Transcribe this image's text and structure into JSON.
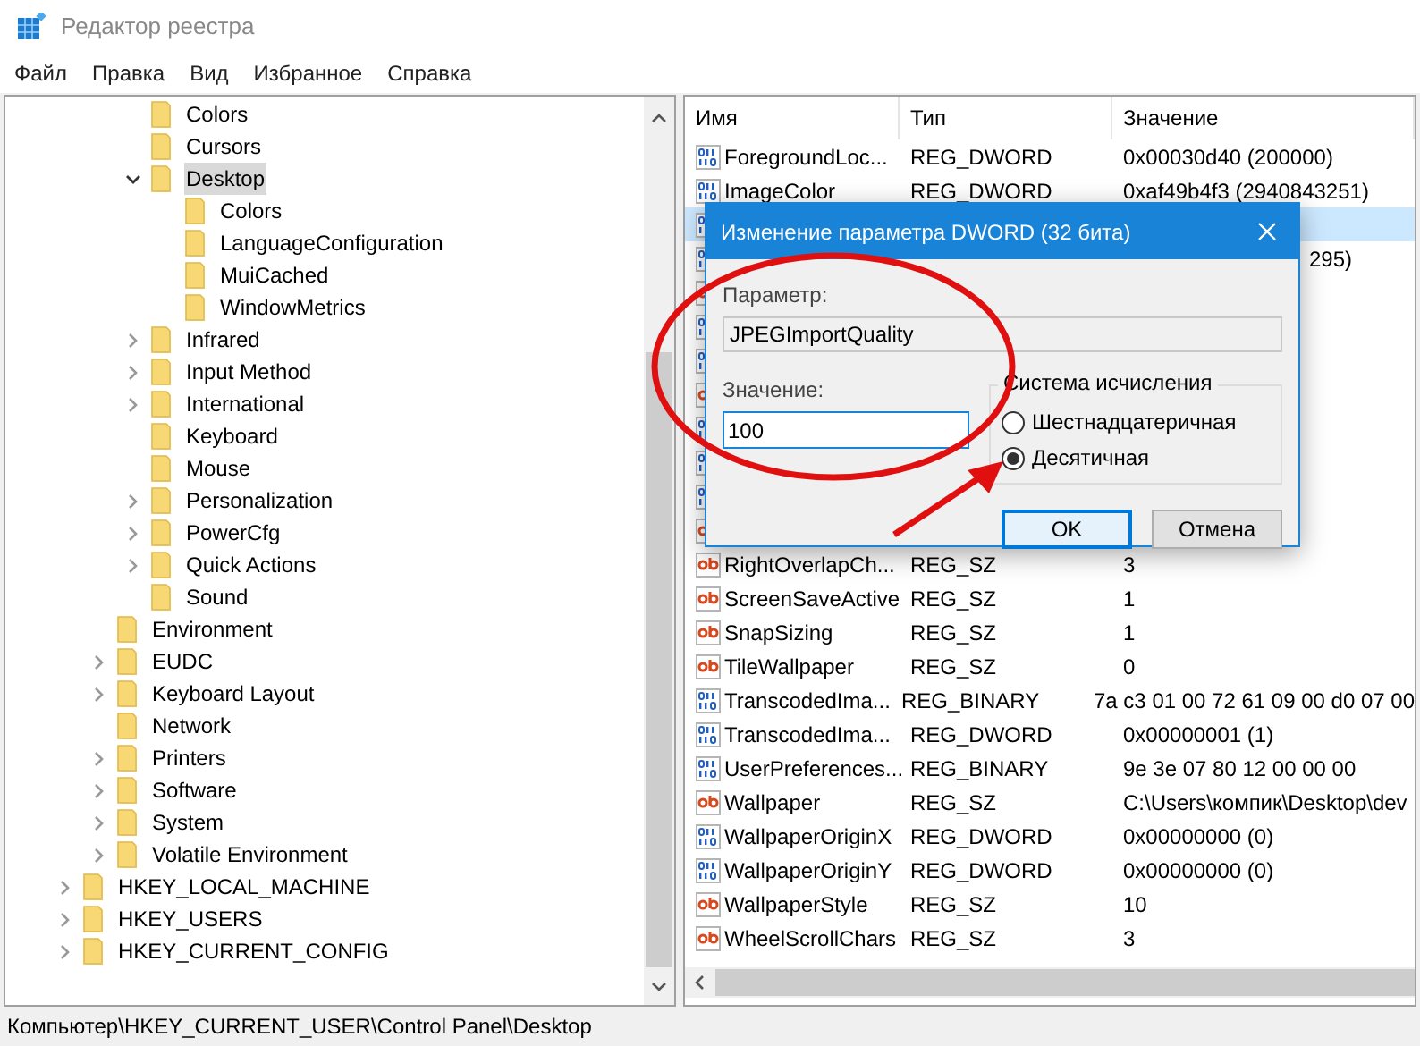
{
  "window": {
    "title": "Редактор реестра"
  },
  "menu": [
    "Файл",
    "Правка",
    "Вид",
    "Избранное",
    "Справка"
  ],
  "tree": [
    {
      "children": [
        {
          "children": [
            {
              "label": "Colors",
              "selected": false
            },
            {
              "label": "Cursors",
              "selected": false
            },
            {
              "label": "Desktop",
              "selected": true,
              "expanded": true,
              "children": [
                {
                  "label": "Colors",
                  "selected": false
                },
                {
                  "label": "LanguageConfiguration",
                  "selected": false
                },
                {
                  "label": "MuiCached",
                  "selected": false
                },
                {
                  "label": "WindowMetrics",
                  "selected": false
                }
              ]
            },
            {
              "label": "Infrared",
              "selected": false,
              "expanded": false
            },
            {
              "label": "Input Method",
              "selected": false,
              "expanded": false
            },
            {
              "label": "International",
              "selected": false,
              "expanded": false
            },
            {
              "label": "Keyboard",
              "selected": false
            },
            {
              "label": "Mouse",
              "selected": false
            },
            {
              "label": "Personalization",
              "selected": false,
              "expanded": false
            },
            {
              "label": "PowerCfg",
              "selected": false,
              "expanded": false
            },
            {
              "label": "Quick Actions",
              "selected": false,
              "expanded": false
            },
            {
              "label": "Sound",
              "selected": false
            }
          ]
        },
        {
          "label": "Environment",
          "selected": false
        },
        {
          "label": "EUDC",
          "selected": false,
          "expanded": false
        },
        {
          "label": "Keyboard Layout",
          "selected": false,
          "expanded": false
        },
        {
          "label": "Network",
          "selected": false
        },
        {
          "label": "Printers",
          "selected": false,
          "expanded": false
        },
        {
          "label": "Software",
          "selected": false,
          "expanded": false
        },
        {
          "label": "System",
          "selected": false,
          "expanded": false
        },
        {
          "label": "Volatile Environment",
          "selected": false,
          "expanded": false
        }
      ]
    },
    {
      "label": "HKEY_LOCAL_MACHINE",
      "selected": false,
      "expanded": false
    },
    {
      "label": "HKEY_USERS",
      "selected": false,
      "expanded": false
    },
    {
      "label": "HKEY_CURRENT_CONFIG",
      "selected": false,
      "expanded": false
    }
  ],
  "table": {
    "columns": [
      "Имя",
      "Тип",
      "Значение"
    ],
    "rows": [
      {
        "kind": "dword",
        "selected": false,
        "name": "ForegroundLoc...",
        "type": "REG_DWORD",
        "value": "0x00030d40 (200000)"
      },
      {
        "kind": "dword",
        "selected": false,
        "name": "ImageColor",
        "type": "REG_DWORD",
        "value": "0xaf49b4f3 (2940843251)"
      },
      {
        "kind": "dword",
        "selected": true
      },
      {
        "kind": "dword",
        "selected": false,
        "value_tail": "295)"
      },
      {
        "kind": "sz",
        "selected": false
      },
      {
        "kind": "dword",
        "selected": false
      },
      {
        "kind": "dword",
        "selected": false
      },
      {
        "kind": "sz",
        "selected": false
      },
      {
        "kind": "dword",
        "selected": false
      },
      {
        "kind": "dword",
        "selected": false
      },
      {
        "kind": "dword",
        "selected": false
      },
      {
        "kind": "sz",
        "selected": false
      },
      {
        "kind": "sz",
        "selected": false,
        "name": "RightOverlapCh...",
        "type": "REG_SZ",
        "value": "3"
      },
      {
        "kind": "sz",
        "selected": false,
        "name": "ScreenSaveActive",
        "type": "REG_SZ",
        "value": "1"
      },
      {
        "kind": "sz",
        "selected": false,
        "name": "SnapSizing",
        "type": "REG_SZ",
        "value": "1"
      },
      {
        "kind": "sz",
        "selected": false,
        "name": "TileWallpaper",
        "type": "REG_SZ",
        "value": "0"
      },
      {
        "kind": "dword",
        "selected": false,
        "name": "TranscodedIma...",
        "type": "REG_BINARY",
        "value": "7a c3 01 00 72 61 09 00 d0 07 00"
      },
      {
        "kind": "dword",
        "selected": false,
        "name": "TranscodedIma...",
        "type": "REG_DWORD",
        "value": "0x00000001 (1)"
      },
      {
        "kind": "dword",
        "selected": false,
        "name": "UserPreferences...",
        "type": "REG_BINARY",
        "value": "9e 3e 07 80 12 00 00 00"
      },
      {
        "kind": "sz",
        "selected": false,
        "name": "Wallpaper",
        "type": "REG_SZ",
        "value": "C:\\Users\\компик\\Desktop\\dev"
      },
      {
        "kind": "dword",
        "selected": false,
        "name": "WallpaperOriginX",
        "type": "REG_DWORD",
        "value": "0x00000000 (0)"
      },
      {
        "kind": "dword",
        "selected": false,
        "name": "WallpaperOriginY",
        "type": "REG_DWORD",
        "value": "0x00000000 (0)"
      },
      {
        "kind": "sz",
        "selected": false,
        "name": "WallpaperStyle",
        "type": "REG_SZ",
        "value": "10"
      },
      {
        "kind": "sz",
        "selected": false,
        "name": "WheelScrollChars",
        "type": "REG_SZ",
        "value": "3"
      }
    ]
  },
  "dialog": {
    "title": "Изменение параметра DWORD (32 бита)",
    "param_label": "Параметр:",
    "param_value": "JPEGImportQuality",
    "value_label": "Значение:",
    "value": "100",
    "base_group": {
      "title": "Система исчисления",
      "options": [
        {
          "label": "Шестнадцатеричная",
          "selected": false
        },
        {
          "label": "Десятичная",
          "selected": true
        }
      ]
    },
    "buttons": [
      {
        "label": "OK",
        "default": true
      },
      {
        "label": "Отмена",
        "default": false
      }
    ]
  },
  "status_bar": "Компьютер\\HKEY_CURRENT_USER\\Control Panel\\Desktop"
}
